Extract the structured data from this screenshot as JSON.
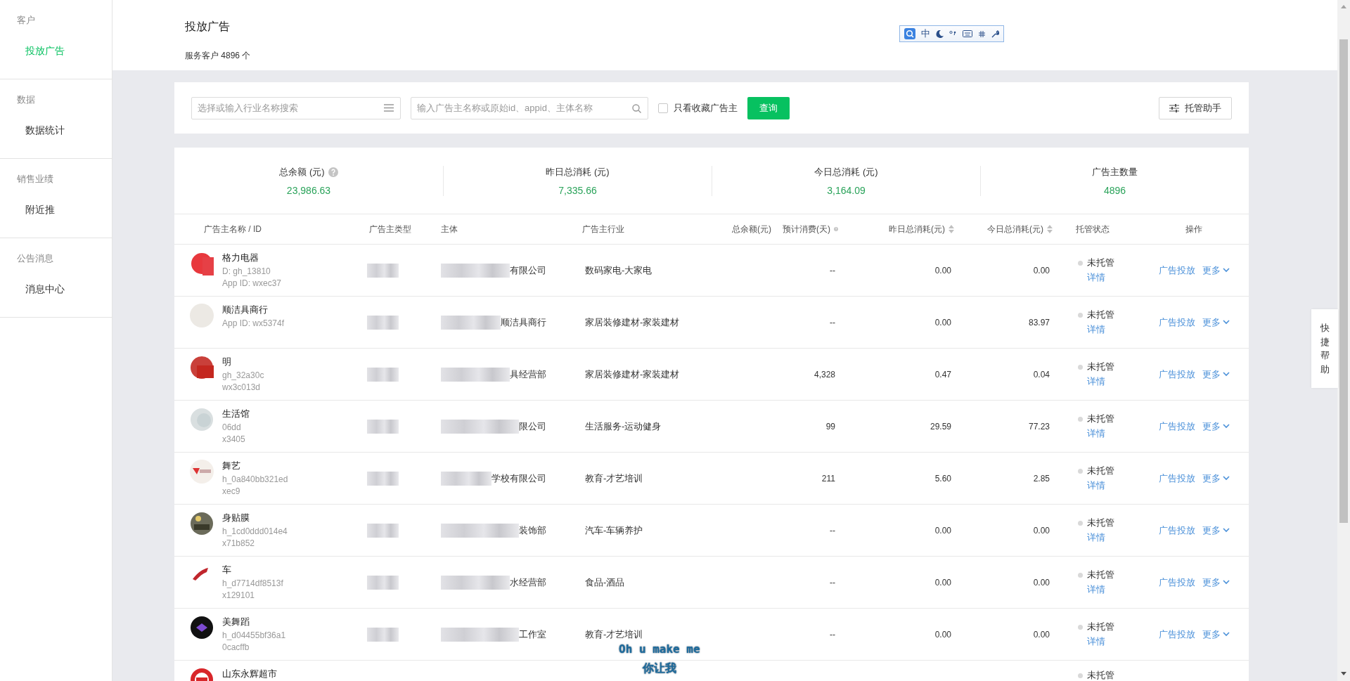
{
  "sidebar": {
    "groups": [
      {
        "title": "客户",
        "items": [
          {
            "label": "投放广告",
            "selected": true
          }
        ]
      },
      {
        "title": "数据",
        "items": [
          {
            "label": "数据统计",
            "selected": false
          }
        ]
      },
      {
        "title": "销售业绩",
        "items": [
          {
            "label": "附近推",
            "selected": false
          }
        ]
      },
      {
        "title": "公告消息",
        "items": [
          {
            "label": "消息中心",
            "selected": false
          }
        ]
      }
    ]
  },
  "header": {
    "title": "投放广告",
    "subtitle": "服务客户 4896 个"
  },
  "ime_toolbar": {
    "mode": "中"
  },
  "filters": {
    "industry_select": {
      "placeholder": "选择或输入行业名称搜索"
    },
    "search": {
      "placeholder": "输入广告主名称或原始id、appid、主体名称"
    },
    "favorites_only": {
      "label": "只看收藏广告主",
      "checked": false
    },
    "query_button": "查询",
    "assistant_button": "托管助手"
  },
  "stats": [
    {
      "label": "总余额 (元)",
      "value": "23,986.63",
      "help": true
    },
    {
      "label": "昨日总消耗 (元)",
      "value": "7,335.66",
      "help": false
    },
    {
      "label": "今日总消耗 (元)",
      "value": "3,164.09",
      "help": false
    },
    {
      "label": "广告主数量",
      "value": "4896",
      "help": false
    }
  ],
  "table": {
    "columns": [
      {
        "label": "广告主名称 / ID",
        "sortable": false,
        "help": false
      },
      {
        "label": "广告主类型",
        "sortable": false,
        "help": false
      },
      {
        "label": "主体",
        "sortable": false,
        "help": false
      },
      {
        "label": "广告主行业",
        "sortable": false,
        "help": false
      },
      {
        "label": "总余额(元)",
        "sortable": false,
        "help": false
      },
      {
        "label": "预计消费(天)",
        "sortable": false,
        "help": true
      },
      {
        "label": "昨日总消耗(元)",
        "sortable": true,
        "help": false
      },
      {
        "label": "今日总消耗(元)",
        "sortable": true,
        "help": false
      },
      {
        "label": "托管状态",
        "sortable": false,
        "help": false
      },
      {
        "label": "操作",
        "sortable": false,
        "help": false
      }
    ],
    "rows": [
      {
        "name": "格力电器",
        "id_line": "D: gh_13810",
        "appid_line": "App ID: wxec37",
        "subject": "有限公司",
        "industry": "数码家电-大家电",
        "forecast": "--",
        "yesterday": "0.00",
        "today": "0.00",
        "status": "未托管",
        "detail": "详情",
        "actions": [
          "广告投放",
          "更多"
        ]
      },
      {
        "name": "顺洁具商行",
        "appid_line": "App ID: wx5374f",
        "subject": "顺洁具商行",
        "industry": "家居装修建材-家装建材",
        "forecast": "--",
        "yesterday": "0.00",
        "today": "83.97",
        "status": "未托管",
        "detail": "详情",
        "actions": [
          "广告投放",
          "更多"
        ]
      },
      {
        "name": "明",
        "id_line": "gh_32a30c",
        "appid_line": "wx3c013d",
        "subject": "具经营部",
        "industry": "家居装修建材-家装建材",
        "forecast": "4,328",
        "yesterday": "0.47",
        "today": "0.04",
        "status": "未托管",
        "detail": "详情",
        "actions": [
          "广告投放",
          "更多"
        ]
      },
      {
        "name": "生活馆",
        "id_line": "06dd",
        "appid_line": "x3405",
        "subject": "限公司",
        "industry": "生活服务-运动健身",
        "forecast": "99",
        "yesterday": "29.59",
        "today": "77.23",
        "status": "未托管",
        "detail": "详情",
        "actions": [
          "广告投放",
          "更多"
        ]
      },
      {
        "name": "舞艺",
        "id_line": "h_0a840bb321ed",
        "appid_line": "xec9",
        "subject": "学校有限公司",
        "industry": "教育-才艺培训",
        "forecast": "211",
        "yesterday": "5.60",
        "today": "2.85",
        "status": "未托管",
        "detail": "详情",
        "actions": [
          "广告投放",
          "更多"
        ]
      },
      {
        "name": "身贴膜",
        "id_line": "h_1cd0ddd014e4",
        "appid_line": "x71b852",
        "subject": "装饰部",
        "industry": "汽车-车辆养护",
        "forecast": "--",
        "yesterday": "0.00",
        "today": "0.00",
        "status": "未托管",
        "detail": "详情",
        "actions": [
          "广告投放",
          "更多"
        ]
      },
      {
        "name": "车",
        "id_line": "h_d7714df8513f",
        "appid_line": "x129101",
        "subject": "水经营部",
        "industry": "食品-酒品",
        "forecast": "--",
        "yesterday": "0.00",
        "today": "0.00",
        "status": "未托管",
        "detail": "详情",
        "actions": [
          "广告投放",
          "更多"
        ]
      },
      {
        "name": "美舞蹈",
        "id_line": "h_d04455bf36a1",
        "appid_line": "0cacffb",
        "subject": "工作室",
        "industry": "教育-才艺培训",
        "forecast": "--",
        "yesterday": "0.00",
        "today": "0.00",
        "status": "未托管",
        "detail": "详情",
        "actions": [
          "广告投放",
          "更多"
        ]
      },
      {
        "name": "山东永辉超市",
        "status": "未托管"
      }
    ]
  },
  "help_tab": "快捷帮助",
  "lyrics": [
    "Oh u make me",
    "你让我"
  ]
}
